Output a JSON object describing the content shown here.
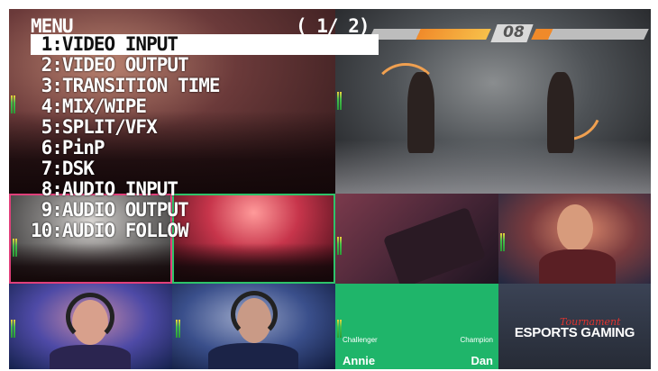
{
  "menu": {
    "title": "MENU",
    "page_indicator": "( 1/ 2)",
    "items": [
      {
        "label": " 1:VIDEO INPUT",
        "selected": true
      },
      {
        "label": " 2:VIDEO OUTPUT",
        "selected": false
      },
      {
        "label": " 3:TRANSITION TIME",
        "selected": false
      },
      {
        "label": " 4:MIX/WIPE",
        "selected": false
      },
      {
        "label": " 5:SPLIT/VFX",
        "selected": false
      },
      {
        "label": " 6:PinP",
        "selected": false
      },
      {
        "label": " 7:DSK",
        "selected": false
      },
      {
        "label": " 8:AUDIO INPUT",
        "selected": false
      },
      {
        "label": " 9:AUDIO OUTPUT",
        "selected": false
      },
      {
        "label": "10:AUDIO FOLLOW",
        "selected": false
      }
    ]
  },
  "game_hud": {
    "timer": "08"
  },
  "lower_third": {
    "left_role": "Challenger",
    "right_role": "Champion",
    "left_name": "Annie",
    "right_name": "Dan"
  },
  "esports_logo": {
    "script_text": "Tournament",
    "main_text": "ESPORTS GAMING"
  },
  "colors": {
    "program_border": "#e0407a",
    "preview_border": "#2ec36a",
    "lower_third_bg": "#1fb56a",
    "logo_accent": "#e0342f"
  }
}
